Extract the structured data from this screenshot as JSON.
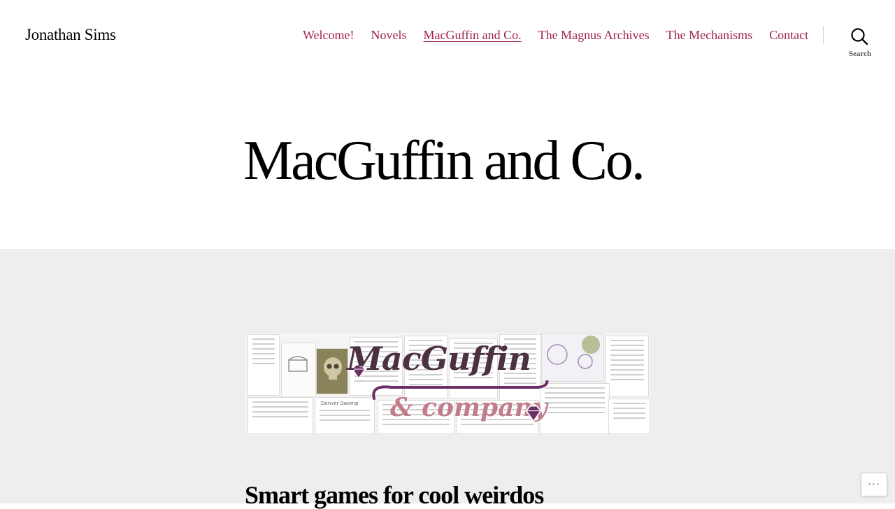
{
  "header": {
    "site_title": "Jonathan Sims",
    "nav": [
      {
        "label": "Welcome!",
        "current": false
      },
      {
        "label": "Novels",
        "current": false
      },
      {
        "label": "MacGuffin and Co.",
        "current": true
      },
      {
        "label": "The Magnus Archives",
        "current": false
      },
      {
        "label": "The Mechanisms",
        "current": false
      }
    ],
    "contact": "Contact",
    "search_label": "Search",
    "search_icon": "search-icon"
  },
  "main": {
    "page_title": "MacGuffin and Co.",
    "banner": {
      "logo_top": "MacGuffin",
      "logo_bottom": "& company"
    },
    "subheading": "Smart games for cool weirdos"
  },
  "footer_actions": {
    "more_icon": "more-icon",
    "more_label": "···"
  },
  "colors": {
    "link": "#a0224f",
    "band_bg": "#eeeeee",
    "logo_dark": "#4b3142",
    "logo_pink": "#c27d8d"
  }
}
